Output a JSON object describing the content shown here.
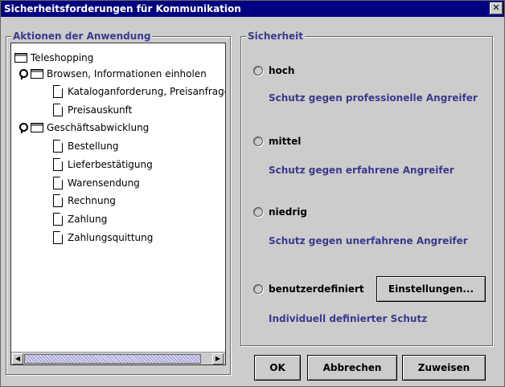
{
  "window": {
    "title": "Sicherheitsforderungen für Kommunikation",
    "close_label": "✕"
  },
  "actions_group": {
    "title": "Aktionen der Anwendung"
  },
  "tree": {
    "root": "Teleshopping",
    "nodes": [
      {
        "label": "Browsen, Informationen einholen"
      },
      {
        "label": "Kataloganforderung, Preisanfrage"
      },
      {
        "label": "Preisauskunft"
      },
      {
        "label": "Geschäftsabwicklung"
      },
      {
        "label": "Bestellung"
      },
      {
        "label": "Lieferbestätigung"
      },
      {
        "label": "Warensendung"
      },
      {
        "label": "Rechnung"
      },
      {
        "label": "Zahlung"
      },
      {
        "label": "Zahlungsquittung"
      }
    ]
  },
  "scrollbar": {
    "left_arrow": "◀",
    "right_arrow": "▶"
  },
  "security_group": {
    "title": "Sicherheit",
    "options": [
      {
        "label": "hoch",
        "desc": "Schutz gegen professionelle Angreifer"
      },
      {
        "label": "mittel",
        "desc": "Schutz gegen erfahrene Angreifer"
      },
      {
        "label": "niedrig",
        "desc": "Schutz gegen unerfahrene Angreifer"
      },
      {
        "label": "benutzerdefiniert",
        "desc": "Individuell definierter Schutz"
      }
    ],
    "settings_button": "Einstellungen..."
  },
  "buttons": {
    "ok": "OK",
    "cancel": "Abbrechen",
    "assign": "Zuweisen"
  },
  "colors": {
    "titlebar": "#000080",
    "group_title": "#3a3a8c",
    "desc_text": "#3a3a8c",
    "background": "#cccccc"
  }
}
